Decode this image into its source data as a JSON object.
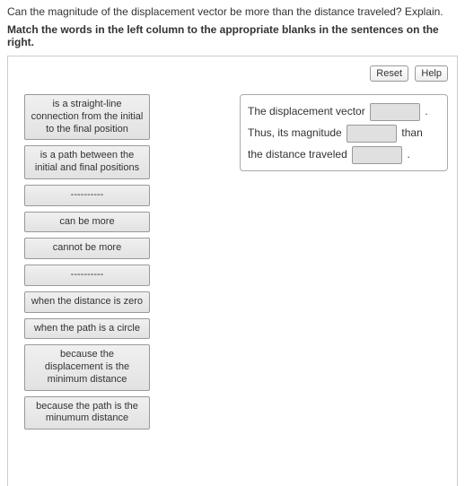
{
  "question": "Can the magnitude of the displacement vector be more than the distance traveled? Explain.",
  "instructions": "Match the words in the left column to the appropriate blanks in the sentences on the right.",
  "buttons": {
    "reset": "Reset",
    "help": "Help"
  },
  "options": [
    "is a straight-line connection from the initial to the final position",
    "is a path between the initial and final positions",
    "----------",
    "can be more",
    "cannot be more",
    "----------",
    "when the distance is zero",
    "when the path is a circle",
    "because the displacement is the minimum distance",
    "because the path is the minumum distance"
  ],
  "sentence": {
    "seg1": "The displacement vector",
    "seg2": ". Thus, its magnitude",
    "seg3": "than the distance traveled",
    "seg4": "."
  }
}
